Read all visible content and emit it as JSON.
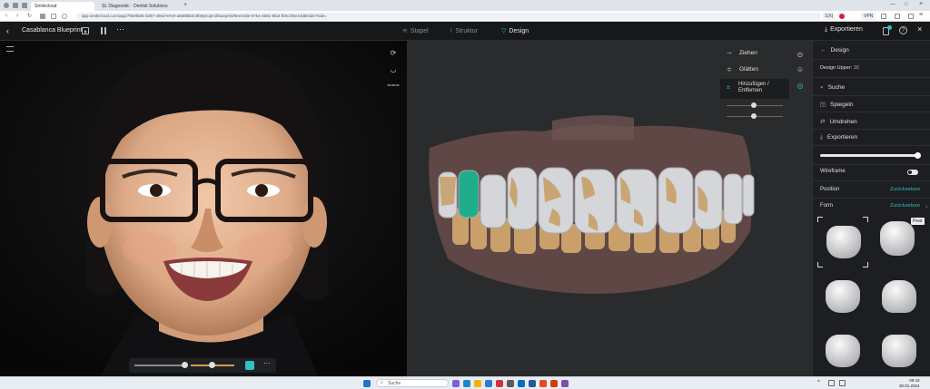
{
  "browser": {
    "tabs": [
      {
        "label": "Smilecloud"
      },
      {
        "label": "SL Diagnostic · Dentist Solutions"
      }
    ],
    "url": "app.smilecloud.com/app/7f8e9b05-3287-49ed-97e0-a558f5b0c9b9/project/blueprint/8ee44de-9754-4b81-8fa4-fb0c3f4e44d8/side?side=",
    "zoom": "1(X)",
    "vpn": "VPN"
  },
  "app": {
    "title": "Casablanca Blueprint",
    "steps": [
      {
        "label": "Stapel"
      },
      {
        "label": "Struktur"
      },
      {
        "label": "Design"
      }
    ],
    "export_label": "Exportieren"
  },
  "tools": {
    "items": [
      {
        "label": "Ziehen"
      },
      {
        "label": "Glätten"
      },
      {
        "label": "Hinzufügen / Entfernen"
      }
    ]
  },
  "panel": {
    "back_label": "Design",
    "design_upper_label": "Design Upper:",
    "design_upper_value": "16",
    "actions": [
      {
        "label": "Suche"
      },
      {
        "label": "Spiegeln"
      },
      {
        "label": "Umdrehen"
      },
      {
        "label": "Exportieren"
      }
    ],
    "wireframe_label": "Wireframe",
    "position_label": "Position",
    "position_reset": "Zurücksetzen",
    "form_label": "Form",
    "form_reset": "Zurücksetzen",
    "tooltip": "Pear"
  },
  "taskbar": {
    "search_placeholder": "Suche",
    "time": "09:43",
    "date": "30.01.2024"
  }
}
